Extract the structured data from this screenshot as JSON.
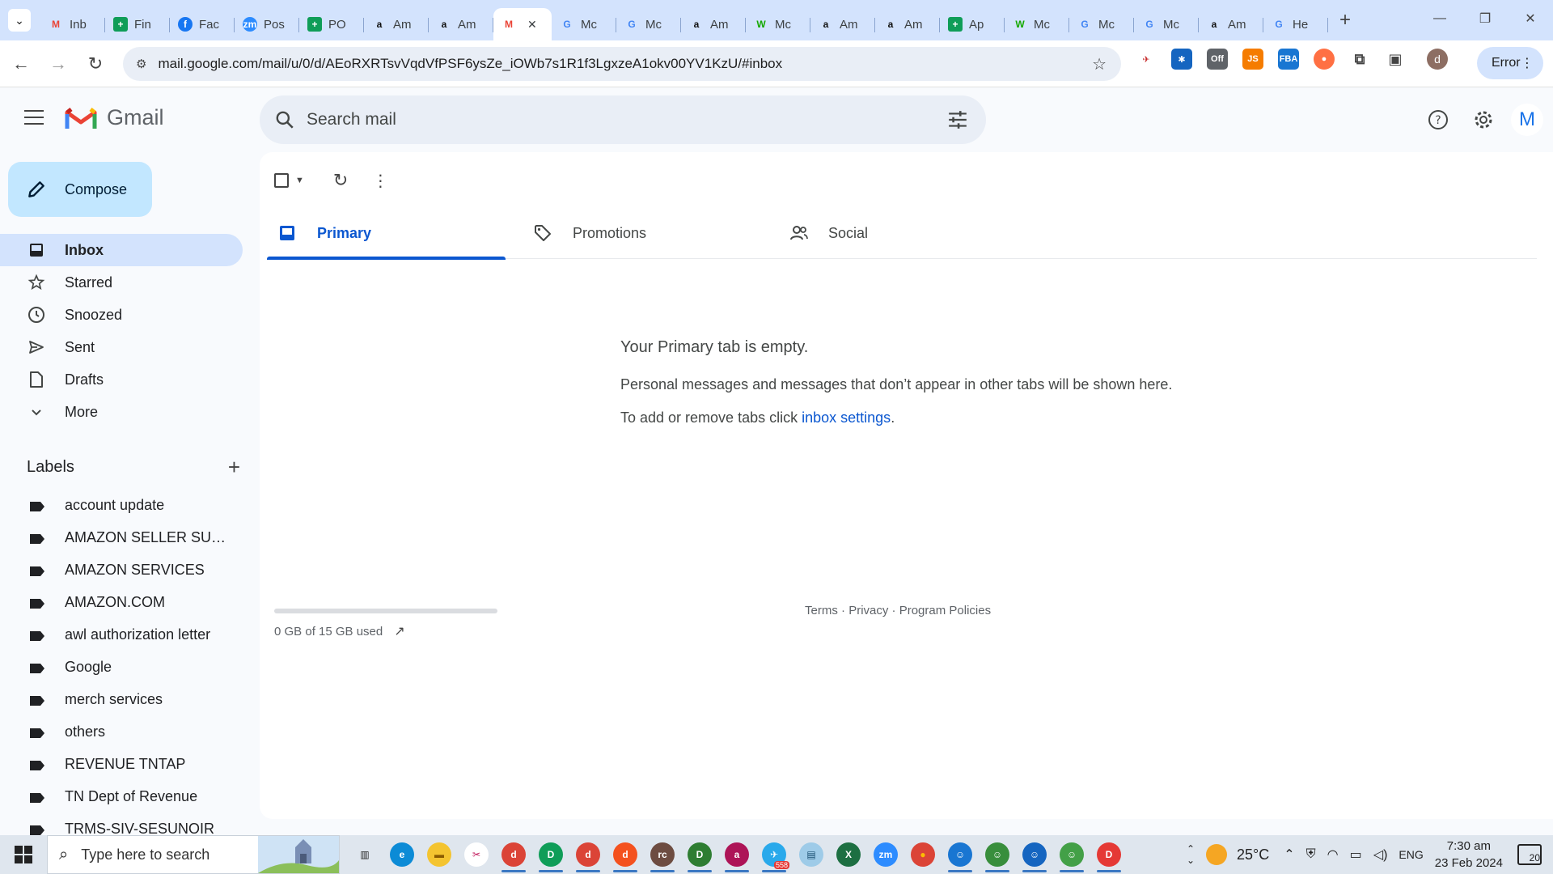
{
  "browser": {
    "tabs": [
      {
        "title": "Inb",
        "icon": "gmail-icon",
        "color": "#ea4335"
      },
      {
        "title": "Fin",
        "icon": "sheets-icon",
        "color": "#0f9d58"
      },
      {
        "title": "Fac",
        "icon": "facebook-icon",
        "color": "#1877f2"
      },
      {
        "title": "Pos",
        "icon": "zoom-icon",
        "color": "#2d8cff"
      },
      {
        "title": "PO",
        "icon": "sheets-icon",
        "color": "#0f9d58"
      },
      {
        "title": "Am",
        "icon": "amazon-icon",
        "color": "#111111"
      },
      {
        "title": "Am",
        "icon": "amazon-icon",
        "color": "#111111"
      },
      {
        "title": "",
        "icon": "gmail-icon",
        "color": "#ea4335",
        "active": true
      },
      {
        "title": "Mc",
        "icon": "google-icon",
        "color": "#4285f4"
      },
      {
        "title": "Mc",
        "icon": "google-icon",
        "color": "#4285f4"
      },
      {
        "title": "Am",
        "icon": "amazon-icon",
        "color": "#111111"
      },
      {
        "title": "Mc",
        "icon": "upwork-icon",
        "color": "#14a800"
      },
      {
        "title": "Am",
        "icon": "amazon-icon",
        "color": "#111111"
      },
      {
        "title": "Am",
        "icon": "amazon-icon",
        "color": "#111111"
      },
      {
        "title": "Ap",
        "icon": "sheets-icon",
        "color": "#0f9d58"
      },
      {
        "title": "Mc",
        "icon": "upwork-icon",
        "color": "#14a800"
      },
      {
        "title": "Mc",
        "icon": "google-icon",
        "color": "#4285f4"
      },
      {
        "title": "Mc",
        "icon": "google-icon",
        "color": "#4285f4"
      },
      {
        "title": "Am",
        "icon": "amazon-icon",
        "color": "#111111"
      },
      {
        "title": "He",
        "icon": "google-icon",
        "color": "#4285f4"
      }
    ],
    "url": "mail.google.com/mail/u/0/d/AEoRXRTsvVqdVfPSF6ysZe_iOWb7s1R1f3LgxzeA1okv00YV1KzU/#inbox",
    "profile_initial": "d",
    "error_label": "Error"
  },
  "gmail": {
    "brand": "Gmail",
    "search_placeholder": "Search mail",
    "avatar_initial": "M",
    "compose_label": "Compose",
    "nav": [
      {
        "label": "Inbox",
        "icon": "inbox-icon",
        "active": true
      },
      {
        "label": "Starred",
        "icon": "star-icon"
      },
      {
        "label": "Snoozed",
        "icon": "clock-icon"
      },
      {
        "label": "Sent",
        "icon": "send-icon"
      },
      {
        "label": "Drafts",
        "icon": "draft-icon"
      },
      {
        "label": "More",
        "icon": "chevron-down-icon"
      }
    ],
    "labels_title": "Labels",
    "labels": [
      "account update",
      "AMAZON SELLER SUPP...",
      "AMAZON SERVICES",
      "AMAZON.COM",
      "awl authorization letter",
      "Google",
      "merch services",
      "others",
      "REVENUE TNTAP",
      "TN Dept of Revenue",
      "TRMS-SIV-SESUNOIR"
    ],
    "tabs": [
      {
        "label": "Primary",
        "icon": "inbox-tab-icon",
        "active": true
      },
      {
        "label": "Promotions",
        "icon": "tag-icon"
      },
      {
        "label": "Social",
        "icon": "people-icon"
      }
    ],
    "empty": {
      "heading": "Your Primary tab is empty.",
      "line1": "Personal messages and messages that don’t appear in other tabs will be shown here.",
      "line2_prefix": "To add or remove tabs click ",
      "line2_link": "inbox settings",
      "line2_suffix": "."
    },
    "storage": {
      "text": "0 GB of 15 GB used",
      "fraction": 0.0
    },
    "footer": {
      "terms": "Terms",
      "privacy": "Privacy",
      "policies": "Program Policies",
      "sep": " · "
    }
  },
  "taskbar": {
    "search_placeholder": "Type here to search",
    "temperature": "25°C",
    "language": "ENG",
    "time": "7:30 am",
    "date": "23 Feb 2024",
    "notification_count": "20",
    "telegram_badge": "558"
  },
  "colors": {
    "accent": "#0b57d0",
    "compose_bg": "#c2e7ff",
    "active_nav_bg": "#d3e3fd"
  }
}
